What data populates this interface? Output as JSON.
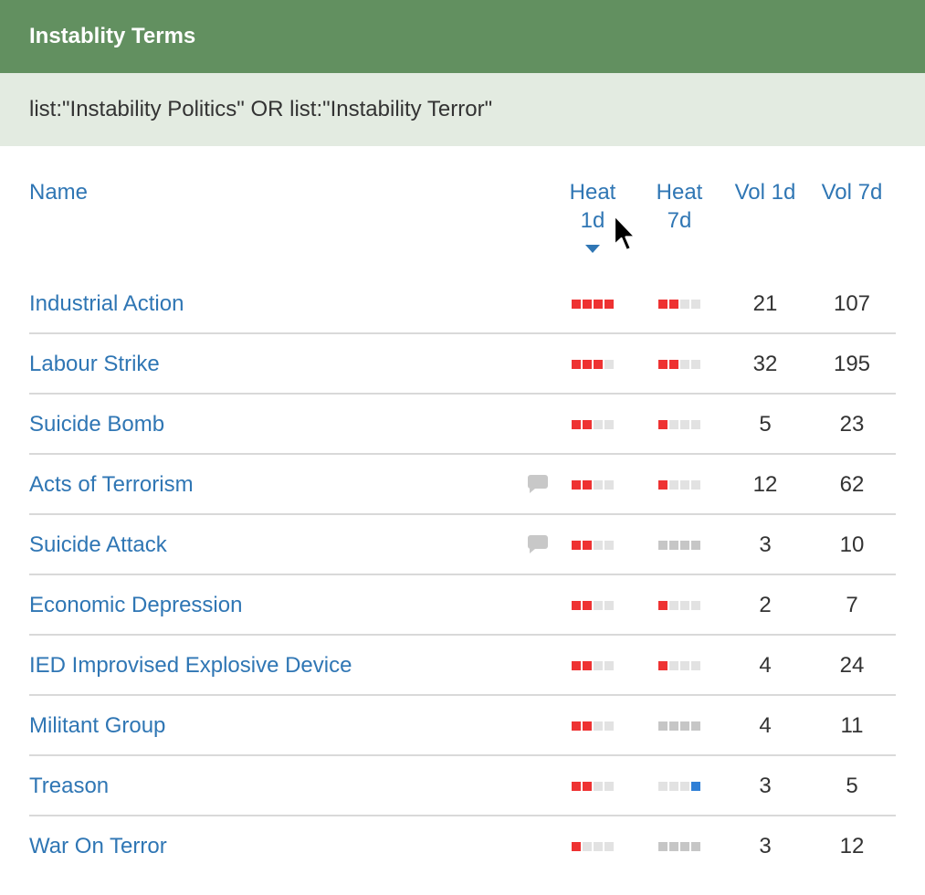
{
  "header": {
    "title": "Instablity Terms"
  },
  "query": {
    "text": "list:\"Instability Politics\" OR list:\"Instability Terror\""
  },
  "columns": {
    "name": "Name",
    "heat1d_line1": "Heat",
    "heat1d_line2": "1d",
    "heat7d_line1": "Heat",
    "heat7d_line2": "7d",
    "vol1d": "Vol 1d",
    "vol7d": "Vol 7d",
    "sorted_by": "Heat 1d",
    "sort_direction": "descending"
  },
  "colors": {
    "heat_high": "#ee3232",
    "heat_cool": "#2f7fd6",
    "heat_none": "#c6c6c6",
    "heat_empty": "#e2e2e2"
  },
  "rows": [
    {
      "name": "Industrial Action",
      "comment": false,
      "heat1d": [
        "red",
        "red",
        "red",
        "red"
      ],
      "heat7d": [
        "red",
        "red",
        "empty",
        "empty"
      ],
      "vol1d": "21",
      "vol7d": "107"
    },
    {
      "name": "Labour Strike",
      "comment": false,
      "heat1d": [
        "red",
        "red",
        "red",
        "empty"
      ],
      "heat7d": [
        "red",
        "red",
        "empty",
        "empty"
      ],
      "vol1d": "32",
      "vol7d": "195"
    },
    {
      "name": "Suicide Bomb",
      "comment": false,
      "heat1d": [
        "red",
        "red",
        "empty",
        "empty"
      ],
      "heat7d": [
        "red",
        "empty",
        "empty",
        "empty"
      ],
      "vol1d": "5",
      "vol7d": "23"
    },
    {
      "name": "Acts of Terrorism",
      "comment": true,
      "heat1d": [
        "red",
        "red",
        "empty",
        "empty"
      ],
      "heat7d": [
        "red",
        "empty",
        "empty",
        "empty"
      ],
      "vol1d": "12",
      "vol7d": "62"
    },
    {
      "name": "Suicide Attack",
      "comment": true,
      "heat1d": [
        "red",
        "red",
        "empty",
        "empty"
      ],
      "heat7d": [
        "gray",
        "gray",
        "gray",
        "gray"
      ],
      "vol1d": "3",
      "vol7d": "10"
    },
    {
      "name": "Economic Depression",
      "comment": false,
      "heat1d": [
        "red",
        "red",
        "empty",
        "empty"
      ],
      "heat7d": [
        "red",
        "empty",
        "empty",
        "empty"
      ],
      "vol1d": "2",
      "vol7d": "7"
    },
    {
      "name": "IED Improvised Explosive Device",
      "comment": false,
      "heat1d": [
        "red",
        "red",
        "empty",
        "empty"
      ],
      "heat7d": [
        "red",
        "empty",
        "empty",
        "empty"
      ],
      "vol1d": "4",
      "vol7d": "24"
    },
    {
      "name": "Militant Group",
      "comment": false,
      "heat1d": [
        "red",
        "red",
        "empty",
        "empty"
      ],
      "heat7d": [
        "gray",
        "gray",
        "gray",
        "gray"
      ],
      "vol1d": "4",
      "vol7d": "11"
    },
    {
      "name": "Treason",
      "comment": false,
      "heat1d": [
        "red",
        "red",
        "empty",
        "empty"
      ],
      "heat7d": [
        "empty",
        "empty",
        "empty",
        "blue"
      ],
      "vol1d": "3",
      "vol7d": "5"
    },
    {
      "name": "War On Terror",
      "comment": false,
      "heat1d": [
        "red",
        "empty",
        "empty",
        "empty"
      ],
      "heat7d": [
        "gray",
        "gray",
        "gray",
        "gray"
      ],
      "vol1d": "3",
      "vol7d": "12"
    }
  ]
}
